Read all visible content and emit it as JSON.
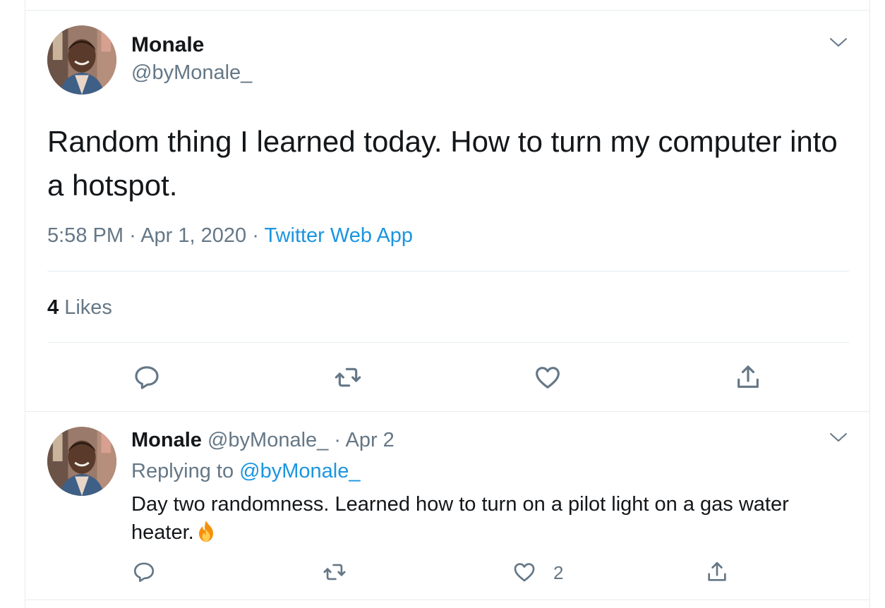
{
  "main_tweet": {
    "author_name": "Monale",
    "author_handle": "@byMonale_",
    "text": "Random thing I learned today. How to turn my computer into a hotspot.",
    "time": "5:58 PM",
    "date": "Apr 1, 2020",
    "separator": "·",
    "source": "Twitter Web App",
    "likes_count": "4",
    "likes_label": "Likes",
    "actions": [
      "reply-icon",
      "retweet-icon",
      "like-icon",
      "share-icon"
    ]
  },
  "reply_tweet": {
    "author_name": "Monale",
    "author_handle": "@byMonale_",
    "separator": "·",
    "date": "Apr 2",
    "replying_prefix": "Replying to",
    "replying_to": "@byMonale_",
    "text": "Day two randomness. Learned how to turn on a pilot light on a gas water heater.",
    "emoji": "fire-emoji",
    "like_count": "2",
    "actions": [
      "reply-icon",
      "retweet-icon",
      "like-icon",
      "share-icon"
    ]
  },
  "colors": {
    "text_primary": "#14171a",
    "text_secondary": "#657786",
    "link": "#1b95e0",
    "divider": "#e6ecf0"
  }
}
